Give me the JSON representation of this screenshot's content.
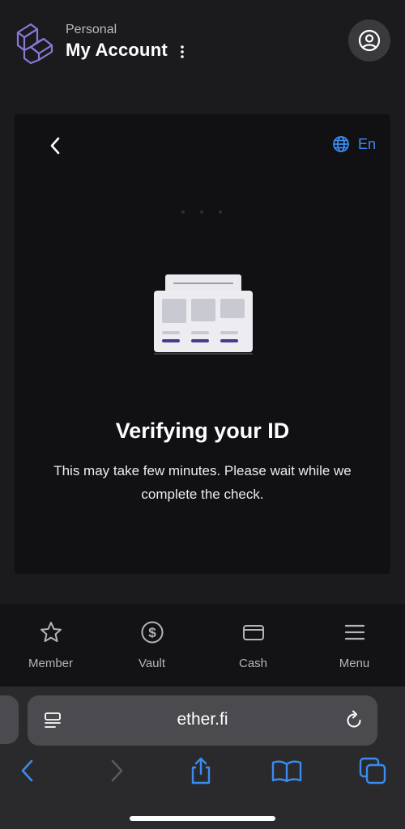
{
  "header": {
    "account_type": "Personal",
    "account_title": "My Account"
  },
  "card": {
    "language": "En",
    "title": "Verifying your ID",
    "description": "This may take few minutes. Please wait while we complete the check."
  },
  "bottom_nav": {
    "items": [
      {
        "label": "Member",
        "icon": "star-icon"
      },
      {
        "label": "Vault",
        "icon": "dollar-coin-icon"
      },
      {
        "label": "Cash",
        "icon": "card-icon"
      },
      {
        "label": "Menu",
        "icon": "hamburger-icon"
      }
    ]
  },
  "browser": {
    "url": "ether.fi"
  },
  "colors": {
    "accent_blue": "#3a8bf2",
    "background": "#1b1b1d",
    "card_background": "#111114",
    "illustration_purple": "#4b3a8c"
  }
}
